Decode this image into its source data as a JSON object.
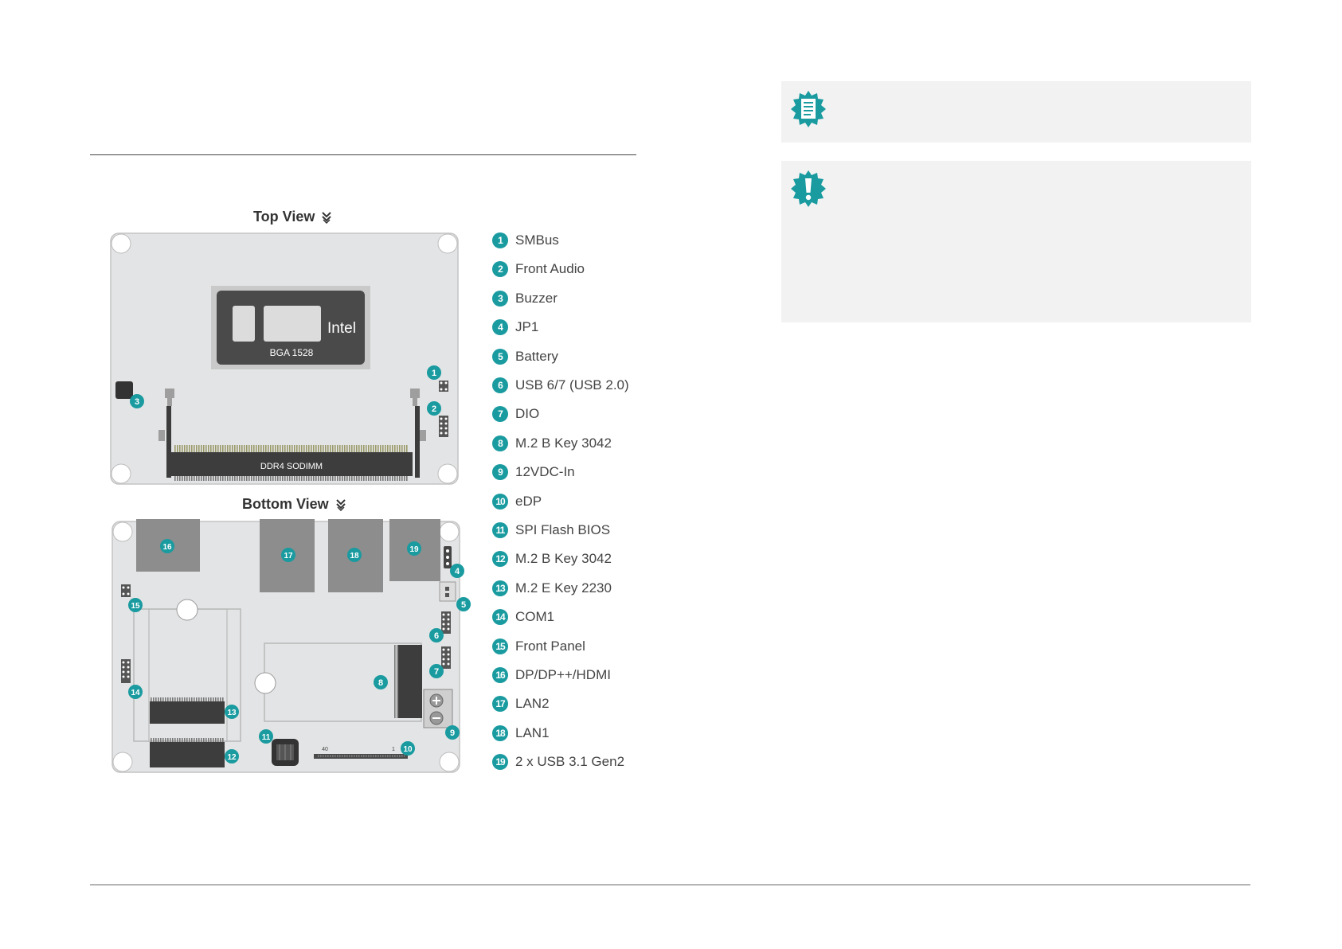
{
  "top_view_title": "Top View",
  "bottom_view_title": "Bottom View",
  "cpu_brand": "Intel",
  "cpu_package": "BGA 1528",
  "memory_slot": "DDR4 SODIMM",
  "edp_pin_start": "40",
  "edp_pin_end": "1",
  "legend": [
    {
      "num": "1",
      "label": "SMBus"
    },
    {
      "num": "2",
      "label": "Front Audio"
    },
    {
      "num": "3",
      "label": "Buzzer"
    },
    {
      "num": "4",
      "label": "JP1"
    },
    {
      "num": "5",
      "label": "Battery"
    },
    {
      "num": "6",
      "label": "USB 6/7 (USB 2.0)"
    },
    {
      "num": "7",
      "label": "DIO"
    },
    {
      "num": "8",
      "label": "M.2 B Key 3042"
    },
    {
      "num": "9",
      "label": "12VDC-In"
    },
    {
      "num": "10",
      "label": "eDP"
    },
    {
      "num": "11",
      "label": "SPI Flash BIOS"
    },
    {
      "num": "12",
      "label": "M.2 B Key 3042"
    },
    {
      "num": "13",
      "label": "M.2 E Key 2230"
    },
    {
      "num": "14",
      "label": "COM1"
    },
    {
      "num": "15",
      "label": "Front Panel"
    },
    {
      "num": "16",
      "label": "DP/DP++/HDMI"
    },
    {
      "num": "17",
      "label": "LAN2"
    },
    {
      "num": "18",
      "label": "LAN1"
    },
    {
      "num": "19",
      "label": "2 x USB 3.1 Gen2"
    }
  ],
  "colors": {
    "accent": "#1a9ba0",
    "board": "#e3e4e5",
    "component": "#8d8d8d",
    "cpu": "#4a4a4a"
  },
  "icons": {
    "note": "note-document-icon",
    "important": "important-exclamation-icon"
  }
}
